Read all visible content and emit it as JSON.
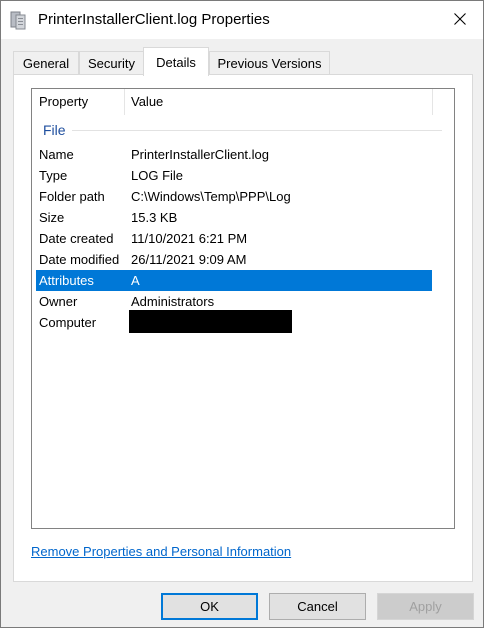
{
  "window": {
    "title": "PrinterInstallerClient.log Properties",
    "icon": "file-properties-icon",
    "close_icon": "close-icon"
  },
  "tabs": [
    {
      "label": "General",
      "active": false
    },
    {
      "label": "Security",
      "active": false
    },
    {
      "label": "Details",
      "active": true
    },
    {
      "label": "Previous Versions",
      "active": false
    }
  ],
  "details": {
    "headers": {
      "property": "Property",
      "value": "Value"
    },
    "group": "File",
    "rows": [
      {
        "property": "Name",
        "value": "PrinterInstallerClient.log"
      },
      {
        "property": "Type",
        "value": "LOG File"
      },
      {
        "property": "Folder path",
        "value": "C:\\Windows\\Temp\\PPP\\Log"
      },
      {
        "property": "Size",
        "value": "15.3 KB"
      },
      {
        "property": "Date created",
        "value": "11/10/2021 6:21 PM"
      },
      {
        "property": "Date modified",
        "value": "26/11/2021 9:09 AM"
      },
      {
        "property": "Attributes",
        "value": "A",
        "selected": true
      },
      {
        "property": "Owner",
        "value": "Administrators"
      },
      {
        "property": "Computer",
        "value": "",
        "redacted": true
      }
    ]
  },
  "link": "Remove Properties and Personal Information",
  "buttons": {
    "ok": "OK",
    "cancel": "Cancel",
    "apply": "Apply"
  },
  "colors": {
    "selection": "#0078d7",
    "link": "#0066cc",
    "group": "#1e4e9e"
  }
}
